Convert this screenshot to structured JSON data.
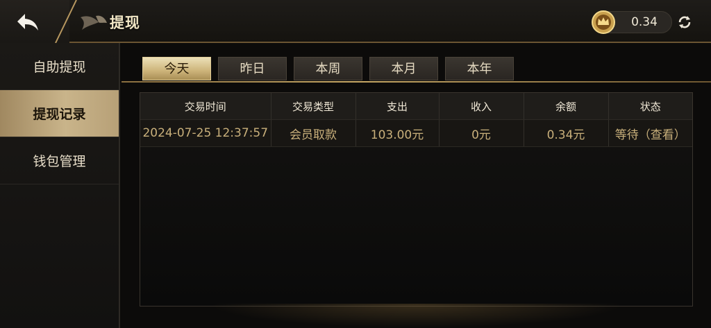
{
  "header": {
    "title": "提现",
    "balance": "0.34",
    "back_icon": "back-arrow-icon",
    "refresh_icon": "refresh-icon",
    "coin_icon": "crown-coin-icon"
  },
  "sidebar": {
    "items": [
      {
        "label": "自助提现",
        "active": false
      },
      {
        "label": "提现记录",
        "active": true
      },
      {
        "label": "钱包管理",
        "active": false
      }
    ]
  },
  "tabs": [
    {
      "label": "今天",
      "active": true
    },
    {
      "label": "昨日",
      "active": false
    },
    {
      "label": "本周",
      "active": false
    },
    {
      "label": "本月",
      "active": false
    },
    {
      "label": "本年",
      "active": false
    }
  ],
  "table": {
    "columns": [
      "交易时间",
      "交易类型",
      "支出",
      "收入",
      "余额",
      "状态"
    ],
    "rows": [
      [
        "2024-07-25 12:37:57",
        "会员取款",
        "103.00元",
        "0元",
        "0.34元",
        "等待（查看）"
      ]
    ]
  },
  "colors": {
    "accent_gold": "#c9b07b",
    "active_tab": "#cdb47a",
    "background": "#0c0b0a"
  }
}
